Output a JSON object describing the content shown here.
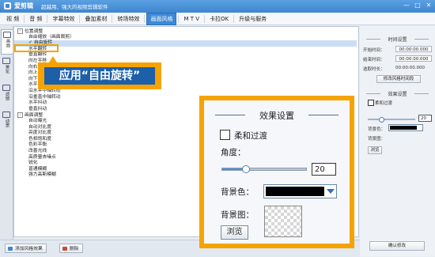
{
  "app": {
    "name": "爱剪辑",
    "slogan": "超越用、强大的视频剪辑软件"
  },
  "window_controls": [
    "—",
    "□",
    "✕"
  ],
  "menu": [
    {
      "label": "视 频",
      "active": false
    },
    {
      "label": "音 频",
      "active": false
    },
    {
      "label": "字幕特效",
      "active": false
    },
    {
      "label": "叠加素材",
      "active": false
    },
    {
      "label": "转场特效",
      "active": false
    },
    {
      "label": "画面风格",
      "active": true
    },
    {
      "label": "M T V",
      "active": false
    },
    {
      "label": "卡拉OK",
      "active": false
    },
    {
      "label": "升级与服务",
      "active": false
    }
  ],
  "side_tabs": [
    {
      "label": "画面",
      "active": true,
      "icon": "picture-icon"
    },
    {
      "label": "美化",
      "active": false,
      "icon": "beautify-icon"
    },
    {
      "label": "滤镜",
      "active": false,
      "icon": "filter-icon"
    },
    {
      "label": "动景",
      "active": false,
      "icon": "motion-icon"
    }
  ],
  "effects_list": [
    {
      "kind": "group",
      "label": "位置调整",
      "expander": "-"
    },
    {
      "kind": "item",
      "label": "自由缩放（画面裁剪）"
    },
    {
      "kind": "item",
      "label": "自由旋转",
      "selected": true,
      "checked": true
    },
    {
      "kind": "item",
      "label": "水平翻转"
    },
    {
      "kind": "item",
      "label": "垂直翻转"
    },
    {
      "kind": "item",
      "label": "向左平移"
    },
    {
      "kind": "item",
      "label": "向右平移"
    },
    {
      "kind": "item",
      "label": "向上平移"
    },
    {
      "kind": "item",
      "label": "向下平移"
    },
    {
      "kind": "item",
      "label": "水平中轴移动"
    },
    {
      "kind": "item",
      "label": "沿水平中轴转动"
    },
    {
      "kind": "item",
      "label": "沿垂直中轴转动"
    },
    {
      "kind": "item",
      "label": "水平抖动"
    },
    {
      "kind": "item",
      "label": "垂直抖动"
    },
    {
      "kind": "group",
      "label": "画面调整",
      "expander": "-"
    },
    {
      "kind": "item",
      "label": "自动曝光"
    },
    {
      "kind": "item",
      "label": "自动对比度"
    },
    {
      "kind": "item",
      "label": "亮度对比度"
    },
    {
      "kind": "item",
      "label": "色相饱和度"
    },
    {
      "kind": "item",
      "label": "色彩平衡"
    },
    {
      "kind": "item",
      "label": "改善光线"
    },
    {
      "kind": "item",
      "label": "高质量去噪点"
    },
    {
      "kind": "item",
      "label": "锐化"
    },
    {
      "kind": "item",
      "label": "普通模糊"
    },
    {
      "kind": "item",
      "label": "强力高斯模糊"
    }
  ],
  "callout": {
    "text": "应用“自由旋转”"
  },
  "right_panel": {
    "time_header": "时间设置",
    "start_label": "开始时间：",
    "start_value": "00:00:00.000",
    "end_label": "结束时间：",
    "end_value": "00:00:00.000",
    "duration_label": "选取时长：",
    "duration_value": "00:00:00.000",
    "modify_time_button": "修改风格时间段",
    "effect_header": "效果设置",
    "soft_label": "柔和过渡",
    "angle_value": "20",
    "bg_color_label": "背景色：",
    "bg_image_label": "背景图：",
    "browse_button": "浏览",
    "confirm_button": "确认修改"
  },
  "bottom_bar": {
    "add_button": "添加风格效果",
    "delete_button": "删除"
  },
  "zoom_panel": {
    "title": "效果设置",
    "soft_label": "柔和过渡",
    "soft_checked": false,
    "angle_label": "角度：",
    "angle_value": "20",
    "angle_fraction": 0.28,
    "bg_color_label": "背景色：",
    "bg_color": "#000000",
    "bg_image_label": "背景图：",
    "browse_button": "浏览"
  },
  "colors": {
    "accent_orange": "#f5a300",
    "callout_blue": "#1d5fa9",
    "menu_active": "#3c8ad8"
  }
}
